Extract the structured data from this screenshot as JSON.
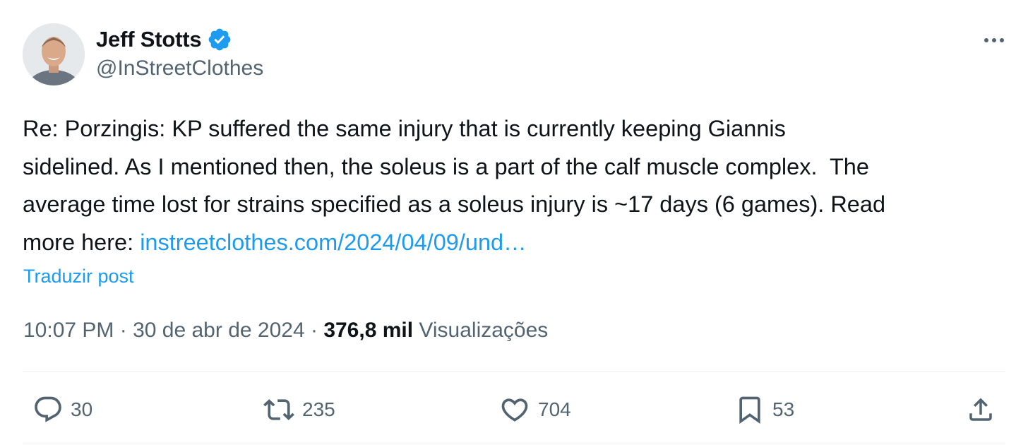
{
  "author": {
    "display_name": "Jeff Stotts",
    "handle": "@InStreetClothes",
    "verified": true
  },
  "tweet": {
    "text_lines": [
      "Re: Porzingis: KP suffered the same injury that is currently keeping Giannis",
      "sidelined. As I mentioned then, the soleus is a part of the calf muscle complex.  The",
      "average time lost for strains specified as a soleus injury is ~17 days (6 games). Read",
      "more here: "
    ],
    "link_text": "instreetclothes.com/2024/04/09/und…",
    "translate_label": "Traduzir post"
  },
  "meta": {
    "time": "10:07 PM",
    "separator1": " · ",
    "date": "30 de abr de 2024",
    "separator2": " · ",
    "views_count": "376,8 mil",
    "views_label": " Visualizações"
  },
  "actions": {
    "replies": "30",
    "reposts": "235",
    "likes": "704",
    "bookmarks": "53"
  },
  "colors": {
    "accent": "#1d9bf0",
    "text": "#0f1419",
    "secondary": "#536471",
    "divider": "#eff3f4"
  },
  "icons": [
    "verified-badge-icon",
    "more-icon",
    "reply-icon",
    "repost-icon",
    "like-icon",
    "bookmark-icon",
    "share-icon"
  ]
}
